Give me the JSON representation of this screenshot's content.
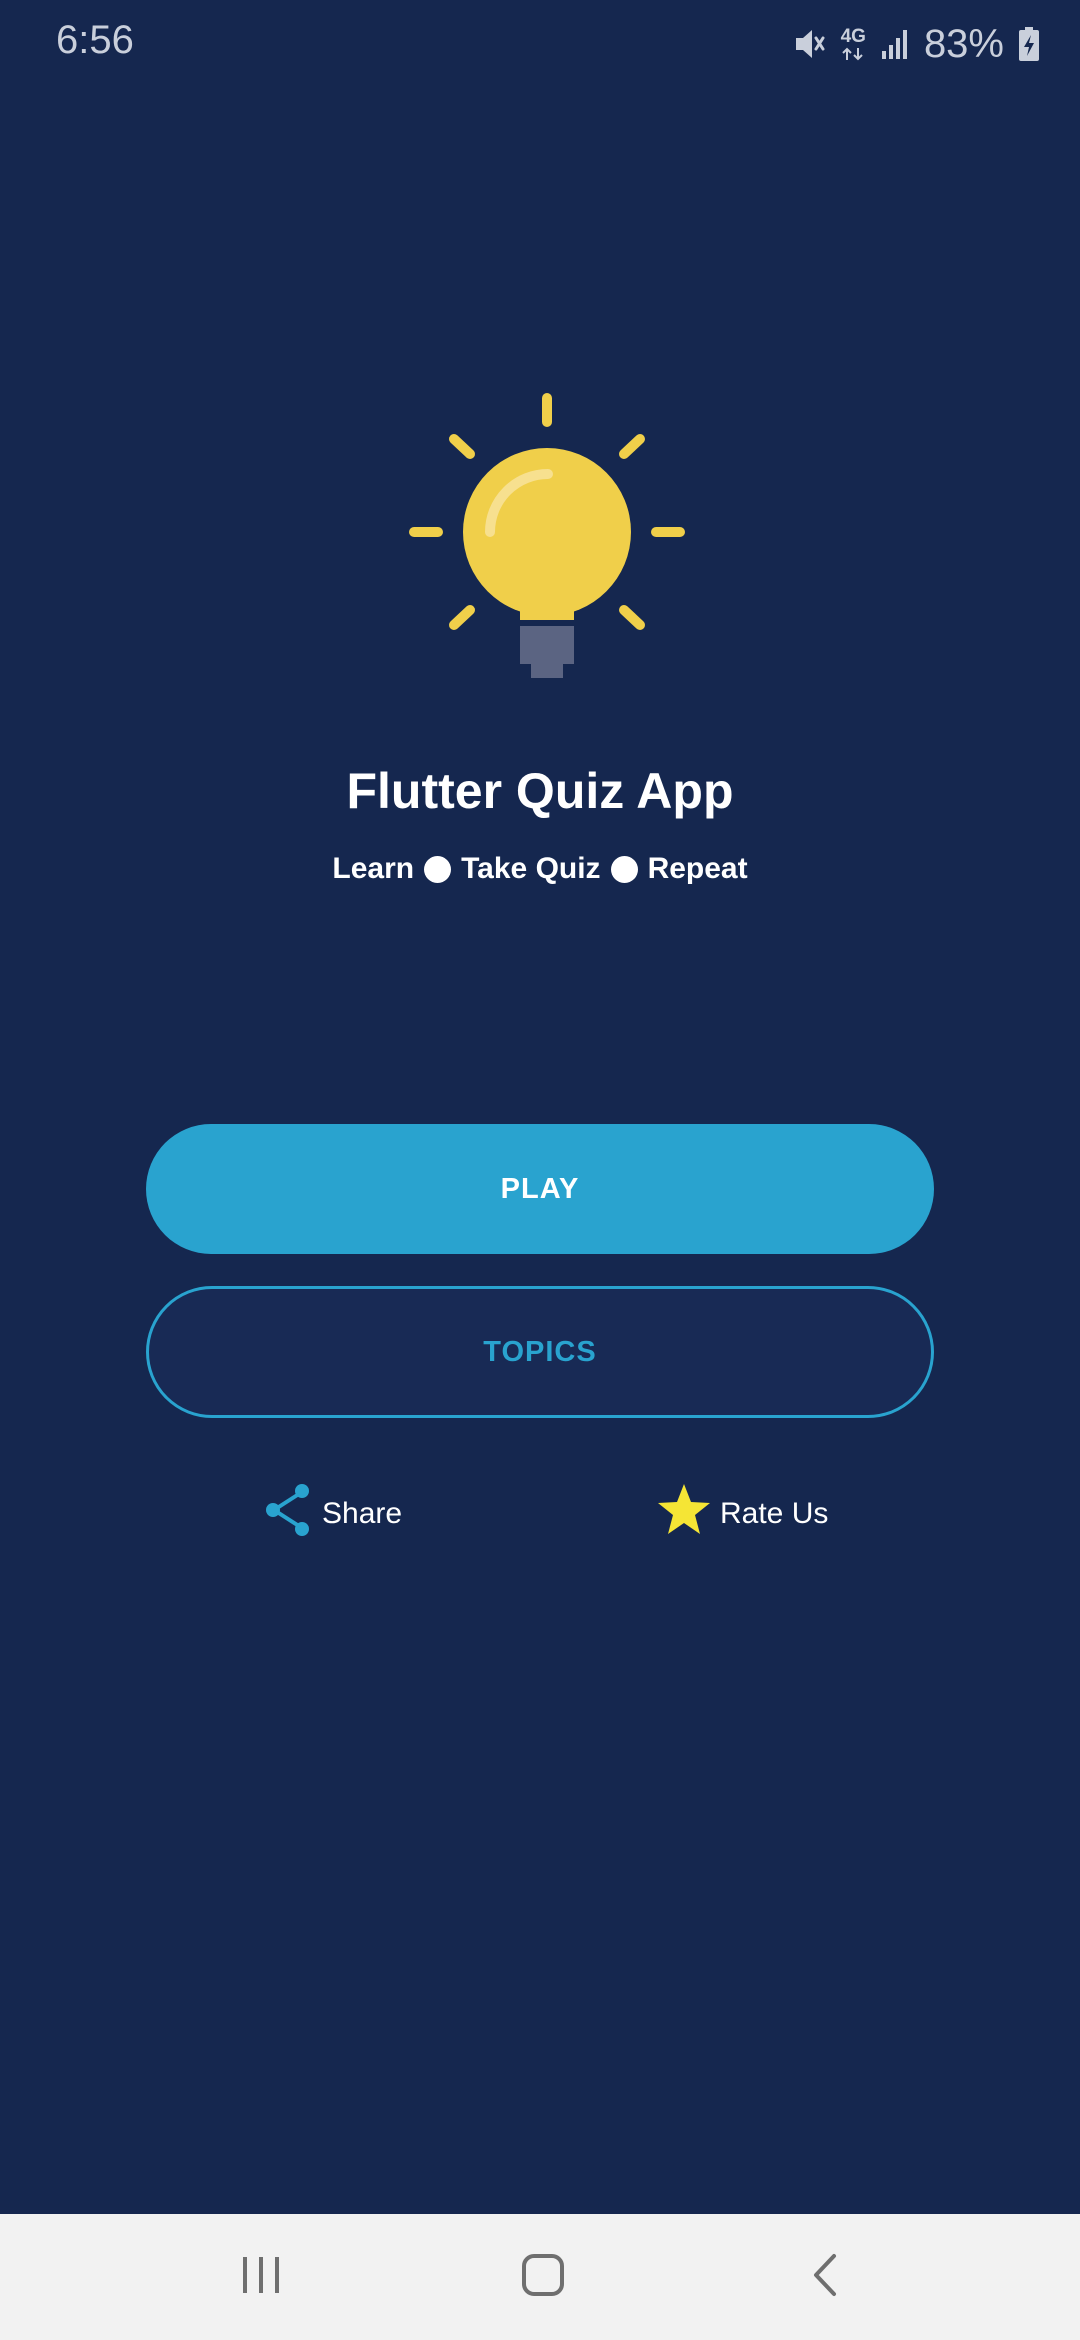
{
  "status_bar": {
    "time": "6:56",
    "network": "4G",
    "battery": "83%",
    "icons": [
      "mute-icon",
      "network-4g-icon",
      "signal-icon",
      "battery-charging-icon"
    ]
  },
  "hero": {
    "icon": "lightbulb-icon",
    "title": "Flutter Quiz App",
    "tagline": [
      "Learn",
      "Take Quiz",
      "Repeat"
    ]
  },
  "actions": {
    "play_label": "PLAY",
    "topics_label": "TOPICS",
    "share_label": "Share",
    "rate_label": "Rate Us"
  },
  "nav": {
    "items": [
      "recent-apps-icon",
      "home-icon",
      "back-icon"
    ]
  },
  "colors": {
    "background": "#15274f",
    "accent": "#29a3cf",
    "bulb": "#f0cf4a",
    "star": "#f5e535",
    "navbar": "#f2f2f2"
  }
}
